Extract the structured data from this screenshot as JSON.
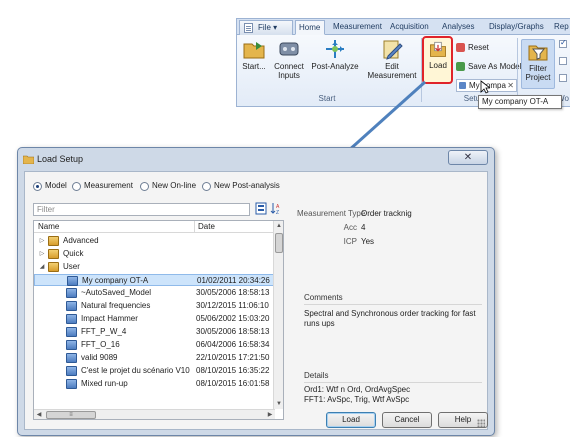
{
  "ribbon": {
    "tabs": [
      "File",
      "Home",
      "Measurement",
      "Acquisition",
      "Analyses",
      "Display/Graphs",
      "Rep"
    ],
    "buttons": {
      "start": "Start...",
      "connect_line1": "Connect",
      "connect_line2": "Inputs",
      "post_analyze": "Post-Analyze",
      "edit_line1": "Edit",
      "edit_line2": "Measurement",
      "load": "Load",
      "reset": "Reset",
      "save_as_model": "Save As Model",
      "combo_value": "My compa",
      "filter_line1": "Filter",
      "filter_line2": "Project"
    },
    "group_start": "Start",
    "group_setup": "Setu",
    "group_wo": "Wo",
    "tooltip": "My company OT-A"
  },
  "dialog": {
    "title": "Load Setup",
    "close_glyph": "✕",
    "radios": [
      "Model",
      "Measurement",
      "New On-line",
      "New Post-analysis"
    ],
    "filter_placeholder": "Filter",
    "columns": {
      "name": "Name",
      "date": "Date"
    },
    "tree": [
      {
        "name": "Advanced",
        "date": "",
        "level": 0,
        "expander": "▷",
        "kind": "folder"
      },
      {
        "name": "Quick",
        "date": "",
        "level": 0,
        "expander": "▷",
        "kind": "folder"
      },
      {
        "name": "User",
        "date": "",
        "level": 0,
        "expander": "◢",
        "kind": "folder"
      },
      {
        "name": "My company OT-A",
        "date": "01/02/2011 20:34:26",
        "level": 1,
        "kind": "file",
        "selected": true
      },
      {
        "name": "~AutoSaved_Model",
        "date": "30/05/2006 18:58:13",
        "level": 1,
        "kind": "file"
      },
      {
        "name": "Natural frequencies",
        "date": "30/12/2015 11:06:10",
        "level": 1,
        "kind": "file"
      },
      {
        "name": "Impact Hammer",
        "date": "05/06/2002 15:03:20",
        "level": 1,
        "kind": "file"
      },
      {
        "name": "FFT_P_W_4",
        "date": "30/05/2006 18:58:13",
        "level": 1,
        "kind": "file"
      },
      {
        "name": "FFT_O_16",
        "date": "06/04/2006 16:58:34",
        "level": 1,
        "kind": "file"
      },
      {
        "name": "valid 9089",
        "date": "22/10/2015 17:21:50",
        "level": 1,
        "kind": "file"
      },
      {
        "name": "C'est le projet du scénario V10",
        "date": "08/10/2015 16:35:22",
        "level": 1,
        "kind": "file"
      },
      {
        "name": "Mixed run-up",
        "date": "08/10/2015 16:01:58",
        "level": 1,
        "kind": "file"
      }
    ],
    "details": {
      "measurement_type_label": "Measurement Type",
      "measurement_type_value": "Order tracknig",
      "acc_label": "Acc",
      "acc_value": "4",
      "icp_label": "ICP",
      "icp_value": "Yes",
      "comments_heading": "Comments",
      "comments_text": "Spectral and Synchronous order tracking for fast runs ups",
      "details_heading": "Details",
      "details_line1": "Ord1: Wtf n Ord, OrdAvgSpec",
      "details_line2": "FFT1: AvSpc, Trig, Wtf AvSpc"
    },
    "buttons": {
      "load": "Load",
      "cancel": "Cancel",
      "help": "Help"
    }
  },
  "colors": {
    "ribbon_bg": "#dfe8f5",
    "highlight_red": "#e0232a",
    "selection_bg": "#cde4fb",
    "arrow": "#4f81bd"
  }
}
